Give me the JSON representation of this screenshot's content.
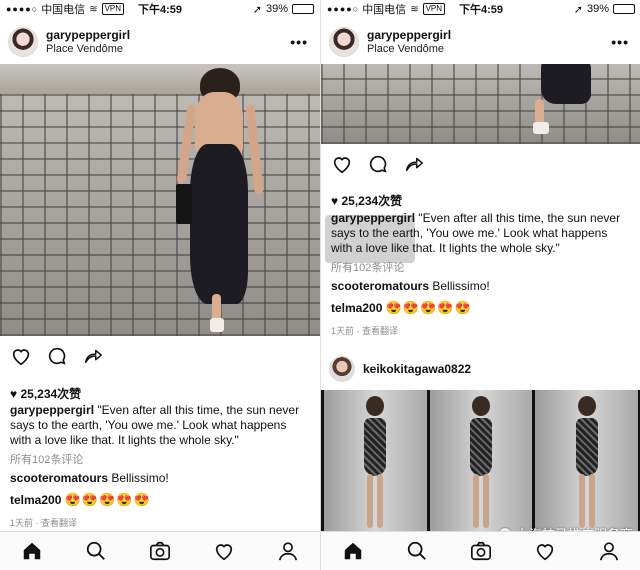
{
  "status_bar": {
    "carrier": "中国电信",
    "network": "VPN",
    "time": "下午4:59",
    "battery": "39%",
    "battery_level": 0.39
  },
  "post": {
    "username": "garypeppergirl",
    "location": "Place Vendôme",
    "more": "•••",
    "likes": "25,234次赞",
    "caption_user": "garypeppergirl",
    "caption_text": "\"Even after all this time, the sun never says to the earth, 'You owe me.' Look what happens with a love like that. It lights the whole sky.\"",
    "view_all_comments": "所有102条评论",
    "comments": [
      {
        "user": "scooteromatours",
        "text": "Bellissimo!"
      },
      {
        "user": "telma200",
        "text": "😍😍😍😍😍"
      }
    ],
    "time_ago": "1天前",
    "see_translation": "查看翻译"
  },
  "next_post": {
    "username": "keikokitagawa0822"
  },
  "icons": {
    "like": "heart-icon",
    "comment": "comment-icon",
    "share": "share-icon",
    "home": "home-icon",
    "search": "search-icon",
    "camera": "camera-icon",
    "activity": "heart-icon",
    "profile": "profile-icon"
  },
  "watermark": "上海神马推广服务商"
}
